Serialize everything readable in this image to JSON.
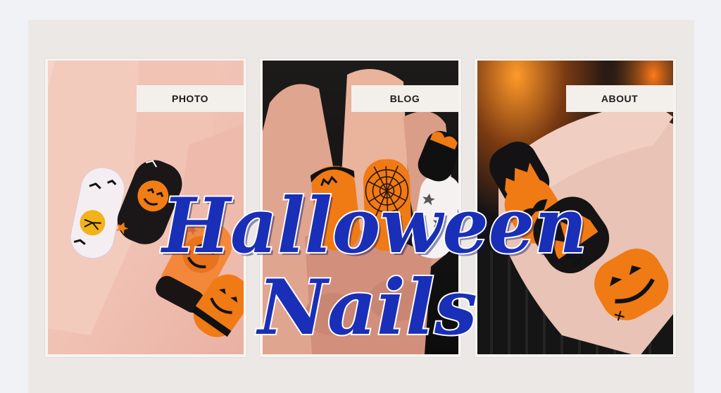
{
  "panels": [
    {
      "label": "PHOTO",
      "icon": "nail-photo"
    },
    {
      "label": "BLOG",
      "icon": "nail-photo"
    },
    {
      "label": "ABOUT",
      "icon": "nail-photo"
    }
  ],
  "title": {
    "line1": "Halloween",
    "line2": "Nails"
  },
  "colors": {
    "page_bg": "#f1f2f6",
    "board_bg": "#ece8e5",
    "label_bg": "#f3efea",
    "title_fill": "#1a2fb8",
    "title_stroke": "#ffffff",
    "nail_orange": "#f07a14",
    "nail_black": "#141414",
    "skin": "#f2c6b6"
  }
}
